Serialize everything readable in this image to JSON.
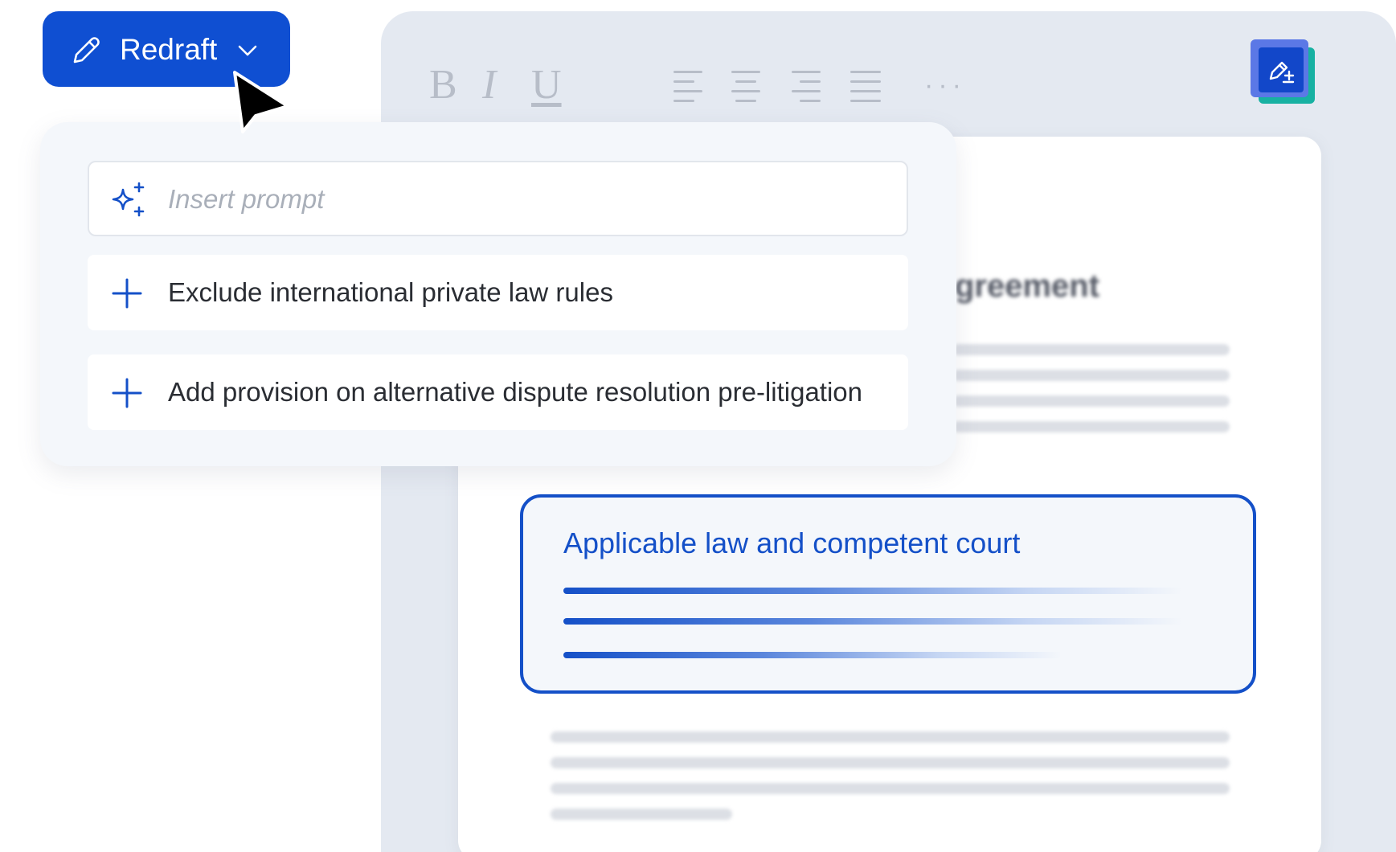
{
  "redraft_button": {
    "label": "Redraft"
  },
  "prompt": {
    "placeholder": "Insert prompt",
    "value": ""
  },
  "suggestions": [
    {
      "label": "Exclude international private law rules"
    },
    {
      "label": "Add provision on alternative dispute resolution pre-litigation"
    }
  ],
  "toolbar": {
    "bold": "B",
    "italic": "I",
    "underline": "U",
    "more": "···",
    "icons": [
      "bold-icon",
      "italic-icon",
      "underline-icon",
      "align-left-icon",
      "align-center-icon",
      "align-right-icon",
      "align-justify-icon",
      "more-icon",
      "ai-redraft-icon"
    ]
  },
  "document": {
    "title_fragment": "greement",
    "clause_title": "Applicable law and competent court"
  },
  "colors": {
    "primary": "#0f4fd2",
    "clause_border": "#1450c8",
    "badge_front": "#5b78e6",
    "badge_back": "#17b1a2"
  }
}
